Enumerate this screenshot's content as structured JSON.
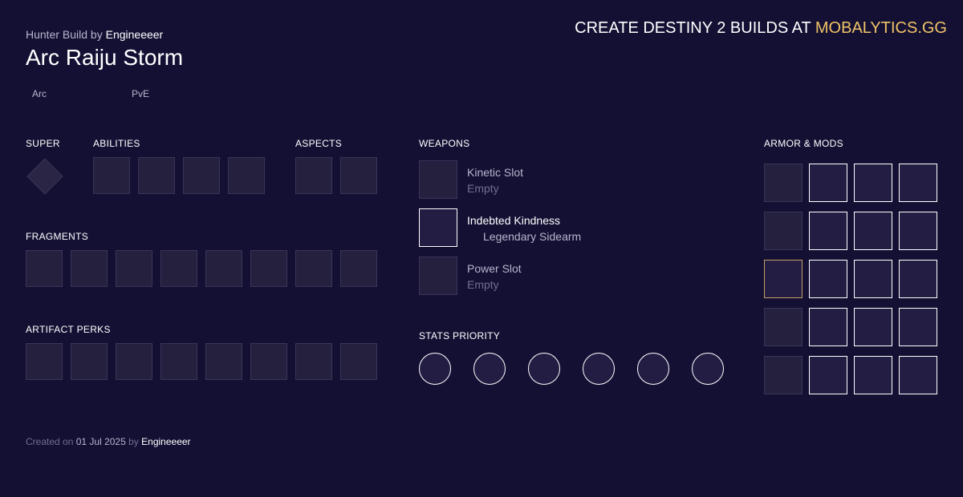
{
  "header": {
    "build_prefix": "Hunter Build by",
    "author": "Engineeeer",
    "title": "Arc Raiju Storm",
    "tags": [
      "Arc",
      "PvE"
    ]
  },
  "promo": {
    "text": "CREATE DESTINY 2 BUILDS AT",
    "site": "MOBALYTICS.GG"
  },
  "sections": {
    "super": "SUPER",
    "abilities": "ABILITIES",
    "aspects": "ASPECTS",
    "fragments": "FRAGMENTS",
    "artifact_perks": "ARTIFACT PERKS",
    "weapons": "WEAPONS",
    "stats_priority": "STATS PRIORITY",
    "armor_mods": "ARMOR & MODS"
  },
  "weapons": [
    {
      "name": "Kinetic Slot",
      "sub": "Empty",
      "equipped": false
    },
    {
      "name": "Indebted Kindness",
      "sub": "Legendary Sidearm",
      "equipped": true
    },
    {
      "name": "Power Slot",
      "sub": "Empty",
      "equipped": false
    }
  ],
  "footer": {
    "created_on": "Created on",
    "date": "01 Jul 2025",
    "by": "by",
    "author": "Engineeeer"
  },
  "colors": {
    "background": "#141034",
    "accent": "#f0c366",
    "slot_empty": "#25203e",
    "slot_border": "#3a3558",
    "slot_active_border": "#ffffff",
    "exotic_border": "#c4a062",
    "muted_text": "#b7b4cc",
    "dim_text": "#726d90"
  }
}
